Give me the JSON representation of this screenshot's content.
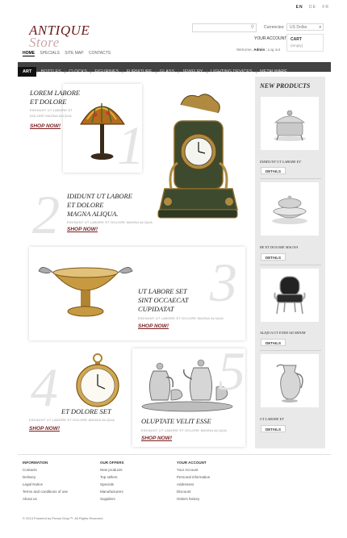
{
  "lang": [
    "EN",
    "DE",
    "FR"
  ],
  "logo": {
    "line1": "ANTIQUE",
    "line2": "Store"
  },
  "search": {
    "placeholder": ""
  },
  "currency": {
    "label": "Currencies:",
    "selected": "US Dollar"
  },
  "account_link": "YOUR ACCOUNT",
  "cart": {
    "title": "CART",
    "status": "(empty)"
  },
  "welcome": {
    "prefix": "Welcome,",
    "user": "Admin",
    "logout": "Log out"
  },
  "topnav": [
    "HOME",
    "SPECIALS",
    "SITE MAP",
    "CONTACTS"
  ],
  "categories": [
    "ART",
    "BOTTLES",
    "CLOCKS",
    "FIGURINES",
    "FURNITURE",
    "GLASS",
    "JEWELRY",
    "LIGHTING DEVICES",
    "METALWARE"
  ],
  "sidebar": {
    "title": "NEW PRODUCTS",
    "items": [
      {
        "name": "EIMDUNT UT LABORE ET",
        "button": "DETAILS"
      },
      {
        "name": "RE ET DOLORE MAGNA",
        "button": "DETAILS"
      },
      {
        "name": "ALIQUA UT ENIM AD MINIM",
        "button": "DETAILS"
      },
      {
        "name": "UT LABORE ET",
        "button": "DETAILS"
      }
    ]
  },
  "promos": [
    {
      "num": "1",
      "title1": "LOREM LABORE",
      "title2": "ET DOLORE",
      "desc1": "EIDINUNT UT LABORE ET",
      "desc2": "DOLORE MAGNA ALIQUA",
      "cta": "SHOP NOW!"
    },
    {
      "num": "2",
      "title1": "IDIDUNT UT LABORE",
      "title2": "ET DOLORE",
      "title3": "MAGNA ALIQUA.",
      "desc1": "EIDINUNT UT LABORE ET DOLORE MAGNA ALIQUA",
      "cta": "SHOP NOW!"
    },
    {
      "num": "3",
      "title1": "UT LABORE SET",
      "title2": "SINT OCCAECAT",
      "title3": "CUPIDATAT",
      "desc1": "EIDINUNT UT LABORE ET DOLORE MAGNA ALIQUA",
      "cta": "SHOP NOW!"
    },
    {
      "num": "4",
      "title1": "ET DOLORE SET",
      "desc1": "EIDINUNT UT LABORE ET DOLORE MAGNA ALIQUA",
      "cta": "SHOP NOW!"
    },
    {
      "num": "5",
      "title1": "OLUPTATE VELIT ESSE",
      "desc1": "EIDINUNT UT LABORE ET DOLORE MAGNA ALIQUA",
      "cta": "SHOP NOW!"
    }
  ],
  "footer": {
    "col1": {
      "heading": "INFORMATION",
      "items": [
        "Contacts",
        "Delivery",
        "Legal Notice",
        "Terms and conditions of use",
        "About us"
      ]
    },
    "col2": {
      "heading": "OUR OFFERS",
      "items": [
        "New products",
        "Top sellers",
        "Specials",
        "Manufacturers",
        "Suppliers"
      ]
    },
    "col3": {
      "heading": "YOUR ACCOUNT",
      "items": [
        "Your Account",
        "Personal information",
        "Addresses",
        "Discount",
        "Orders history"
      ]
    },
    "copyright": "© 2013 Powered by Presta Shop™. All Rights Reserved"
  }
}
